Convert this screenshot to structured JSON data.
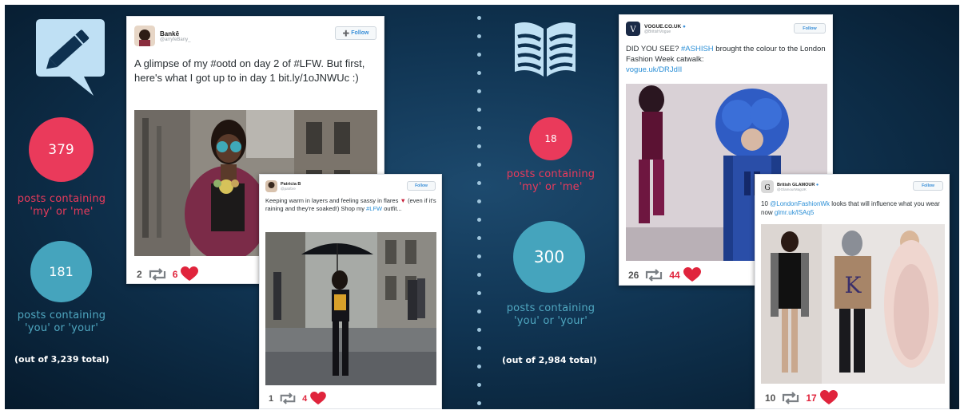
{
  "left": {
    "icon": "pencil-speech-bubble-icon",
    "stat_me": {
      "value": "379",
      "line1": "posts containing",
      "line2": "'my' or 'me'"
    },
    "stat_you": {
      "value": "181",
      "line1": "posts containing",
      "line2": "'you' or 'your'"
    },
    "total": "(out of 3,239 total)",
    "tweet1": {
      "name": "Bankē",
      "handle": "@arryfeBany_",
      "follow": "Follow",
      "text": "A glimpse of my #ootd on day 2 of #LFW. But first, here's what I got up to in day 1 bit.ly/1oJNWUc :)",
      "retweets": "2",
      "likes": "6"
    },
    "tweet2": {
      "name": "Patricia B",
      "handle": "@patrbre",
      "follow": "Follow",
      "text_a": "Keeping warm in layers and feeling sassy in flares",
      "text_b": "(even if it's raining and they're soaked!) Shop my",
      "text_link": "#LFW",
      "text_c": "outfit...",
      "retweets": "1",
      "likes": "4"
    }
  },
  "right": {
    "icon": "open-book-icon",
    "stat_me": {
      "value": "18",
      "line1": "posts containing",
      "line2": "'my' or 'me'"
    },
    "stat_you": {
      "value": "300",
      "line1": "posts containing",
      "line2": "'you' or 'your'"
    },
    "total": "(out of 2,984 total)",
    "tweet3": {
      "name": "VOGUE.CO.UK",
      "handle": "@BritishVogue",
      "follow": "Follow",
      "text_a": "DID YOU SEE?",
      "text_link": "#ASHISH",
      "text_b": "brought the colour to the London Fashion Week catwalk:",
      "url": "vogue.uk/DRJdII",
      "retweets": "26",
      "likes": "44"
    },
    "tweet4": {
      "name": "British GLAMOUR",
      "handle": "@GlamourMagUK",
      "follow": "Follow",
      "text_a": "10",
      "text_link": "@LondonFashionWk",
      "text_b": "looks that will influence what you wear now",
      "url": "glmr.uk/lSAq5",
      "retweets": "10",
      "likes": "17"
    }
  },
  "colors": {
    "red": "#ea3a5b",
    "blue": "#45a4bd",
    "heart": "#e0243c",
    "link": "#2b8fd6"
  }
}
